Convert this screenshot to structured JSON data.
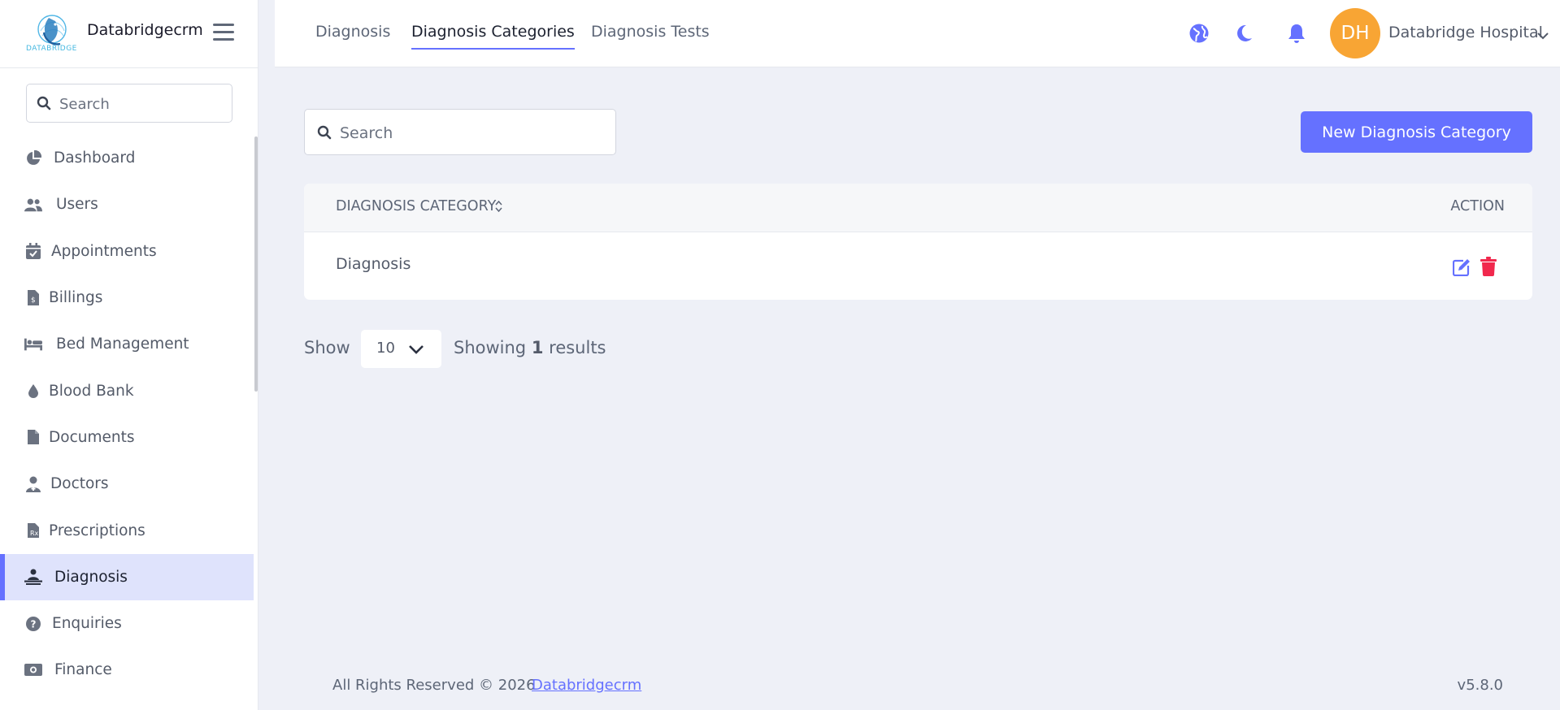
{
  "brand": {
    "name": "Databridgecrm",
    "logo_text": "DATABRIDGE"
  },
  "sidebar": {
    "search_placeholder": "Search",
    "items": [
      {
        "label": "Dashboard",
        "icon": "chart-pie-icon"
      },
      {
        "label": "Users",
        "icon": "users-icon"
      },
      {
        "label": "Appointments",
        "icon": "calendar-check-icon"
      },
      {
        "label": "Billings",
        "icon": "file-invoice-dollar-icon"
      },
      {
        "label": "Bed Management",
        "icon": "bed-icon"
      },
      {
        "label": "Blood Bank",
        "icon": "droplet-icon"
      },
      {
        "label": "Documents",
        "icon": "file-icon"
      },
      {
        "label": "Doctors",
        "icon": "user-doctor-icon"
      },
      {
        "label": "Prescriptions",
        "icon": "prescription-icon"
      },
      {
        "label": "Diagnosis",
        "icon": "person-diagnosis-icon",
        "active": true
      },
      {
        "label": "Enquiries",
        "icon": "question-circle-icon"
      },
      {
        "label": "Finance",
        "icon": "money-bill-icon"
      }
    ]
  },
  "header": {
    "tabs": [
      {
        "label": "Diagnosis"
      },
      {
        "label": "Diagnosis Categories",
        "active": true
      },
      {
        "label": "Diagnosis Tests"
      }
    ],
    "avatar_initials": "DH",
    "user_name": "Databridge Hospital"
  },
  "main": {
    "search_placeholder": "Search",
    "new_button_label": "New Diagnosis Category",
    "table": {
      "columns": [
        "DIAGNOSIS CATEGORY",
        "ACTION"
      ],
      "rows": [
        {
          "category": "Diagnosis"
        }
      ]
    },
    "pagination": {
      "show_label": "Show",
      "per_page": "10",
      "results_prefix": "Showing",
      "results_count": "1",
      "results_suffix": "results"
    }
  },
  "footer": {
    "copyright": "All Rights Reserved © 2026",
    "link_text": "Databridgecrm",
    "version": "v5.8.0"
  },
  "colors": {
    "primary": "#6571ff",
    "danger": "#f1284d",
    "avatar": "#f8a534",
    "active_nav_bg": "#dfe3fc",
    "page_bg": "#eef0f7"
  }
}
